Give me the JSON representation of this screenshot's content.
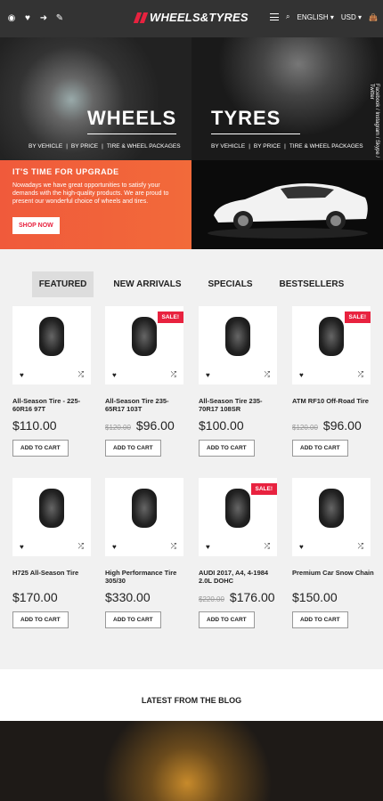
{
  "topbar": {
    "icons": [
      "user-circle-icon",
      "heart-icon",
      "login-icon",
      "pencil-icon"
    ],
    "logo": "WHEELS&TYRES",
    "language": "ENGLISH",
    "currency": "USD"
  },
  "hero": {
    "wheels": {
      "title": "WHEELS",
      "links": [
        "BY VEHICLE",
        "BY PRICE",
        "TIRE & WHEEL PACKAGES"
      ]
    },
    "tyres": {
      "title": "TYRES",
      "links": [
        "BY VEHICLE",
        "BY PRICE",
        "TIRE & WHEEL PACKAGES"
      ]
    },
    "social": "Facebook / Instagram / Skype / Twitter"
  },
  "upgrade": {
    "title": "IT'S TIME FOR UPGRADE",
    "text": "Nowadays we have great opportunities to satisfy your demands with the high-quality products. We are proud to present our wonderful choice of wheels and tires.",
    "button": "SHOP NOW"
  },
  "tabs": [
    "FEATURED",
    "NEW ARRIVALS",
    "SPECIALS",
    "BESTSELLERS"
  ],
  "products": [
    {
      "name": "All-Season Tire - 225-60R16 97T",
      "price": "$110.00",
      "old": "",
      "sale": "",
      "btn": "ADD TO CART"
    },
    {
      "name": "All-Season Tire 235-65R17 103T",
      "price": "$96.00",
      "old": "$120.00",
      "sale": "SALE!",
      "btn": "ADD TO CART"
    },
    {
      "name": "All-Season Tire 235-70R17 108SR",
      "price": "$100.00",
      "old": "",
      "sale": "",
      "btn": "ADD TO CART"
    },
    {
      "name": "ATM RF10 Off-Road Tire",
      "price": "$96.00",
      "old": "$120.00",
      "sale": "SALE!",
      "btn": "ADD TO CART"
    },
    {
      "name": "H725 All-Season Tire",
      "price": "$170.00",
      "old": "",
      "sale": "",
      "btn": "ADD TO CART"
    },
    {
      "name": "High Performance Tire 305/30",
      "price": "$330.00",
      "old": "",
      "sale": "",
      "btn": "ADD TO CART"
    },
    {
      "name": "AUDI 2017, A4, 4-1984 2.0L DOHC",
      "price": "$176.00",
      "old": "$220.00",
      "sale": "SALE!",
      "btn": "ADD TO CART"
    },
    {
      "name": "Premium Car Snow Chain",
      "price": "$150.00",
      "old": "",
      "sale": "",
      "btn": "ADD TO CART"
    }
  ],
  "blog": {
    "title": "LATEST FROM THE BLOG"
  }
}
